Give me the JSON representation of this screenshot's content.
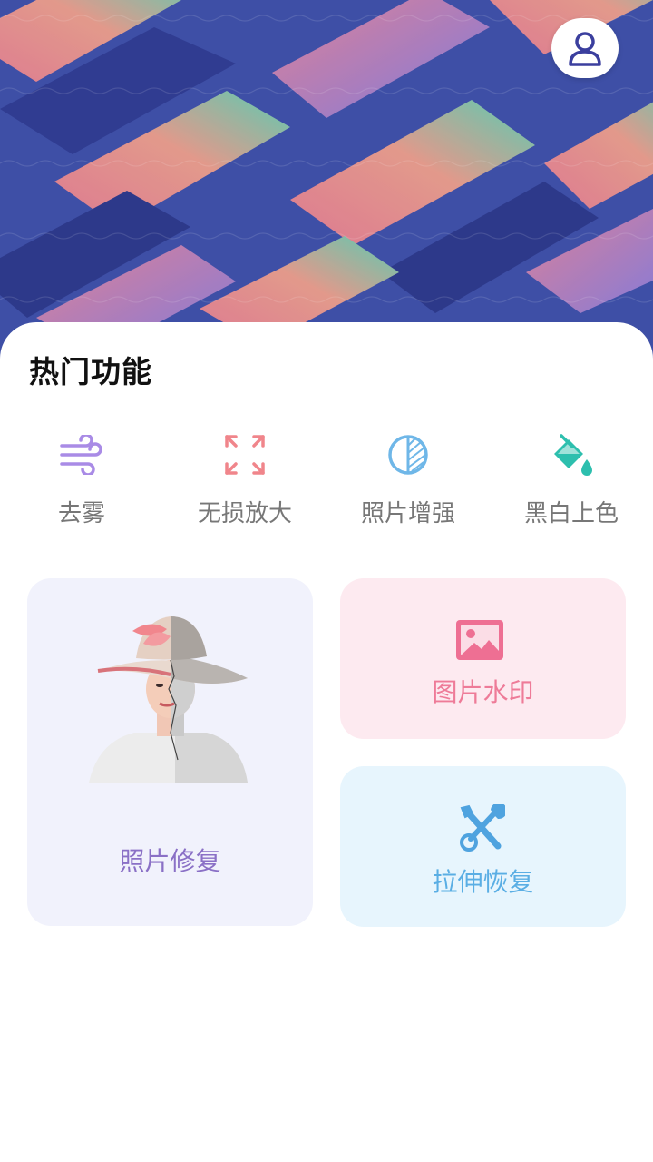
{
  "section": {
    "title": "热门功能"
  },
  "features": [
    {
      "label": "去雾",
      "icon": "wind-icon",
      "color": "#a98be6"
    },
    {
      "label": "无损放大",
      "icon": "expand-icon",
      "color": "#f0858b"
    },
    {
      "label": "照片增强",
      "icon": "contrast-icon",
      "color": "#6fb7e8"
    },
    {
      "label": "黑白上色",
      "icon": "paint-bucket-icon",
      "color": "#2dbfae"
    }
  ],
  "cards": {
    "repair": {
      "label": "照片修复",
      "color": "#8a70c6"
    },
    "watermark": {
      "label": "图片水印",
      "icon": "image-icon",
      "color": "#ee7b98"
    },
    "stretch": {
      "label": "拉伸恢复",
      "icon": "tools-icon",
      "color": "#5aaee4"
    }
  },
  "header": {
    "profile_icon": "user-icon"
  }
}
